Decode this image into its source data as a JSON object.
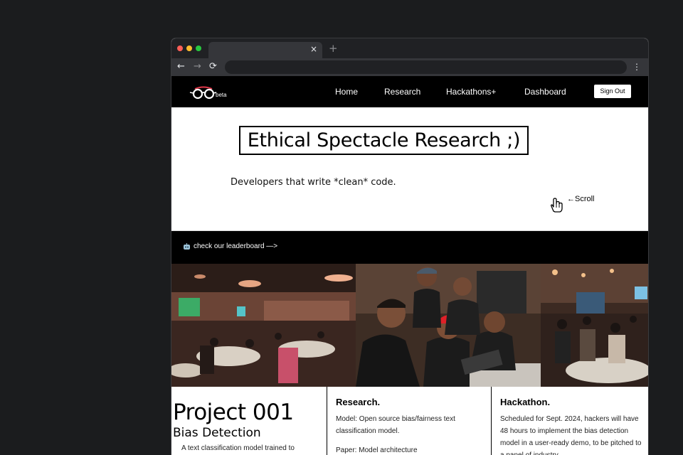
{
  "browser": {
    "tab_close": "×",
    "new_tab": "+",
    "back": "←",
    "forward": "→",
    "reload": "⟳",
    "menu": "⋮",
    "address": ""
  },
  "nav": {
    "logo_badge": "beta",
    "links": [
      "Home",
      "Research",
      "Hackathons+",
      "Dashboard"
    ],
    "sign_out": "Sign Out"
  },
  "hero": {
    "title": "Ethical Spectacle Research ;)",
    "tagline": "Developers that write *clean* code.",
    "scroll_label": "←Scroll"
  },
  "leaderboard": {
    "icon": "robot-icon",
    "text": "check our leaderboard —>"
  },
  "photos": [
    "event-hall-photo",
    "team-coding-photo",
    "restaurant-crowd-photo"
  ],
  "project": {
    "title": "Project 001",
    "subtitle": "Bias Detection",
    "description": "A text classification model trained to"
  },
  "research": {
    "heading": "Research.",
    "model": "Model: Open source bias/fairness text classification model.",
    "paper": "Paper: Model architecture"
  },
  "hackathon": {
    "heading": "Hackathon.",
    "text": "Scheduled for Sept. 2024, hackers will have 48 hours to implement the bias detection model in a user-ready demo, to be pitched to a panel of industry"
  },
  "colors": {
    "page_bg": "#1b1c1e",
    "chrome_dark": "#202124",
    "chrome_toolbar": "#35363a",
    "site_nav": "#000000",
    "accent_red": "#ff5f57",
    "accent_yellow": "#febc2e",
    "accent_green": "#28c840"
  }
}
